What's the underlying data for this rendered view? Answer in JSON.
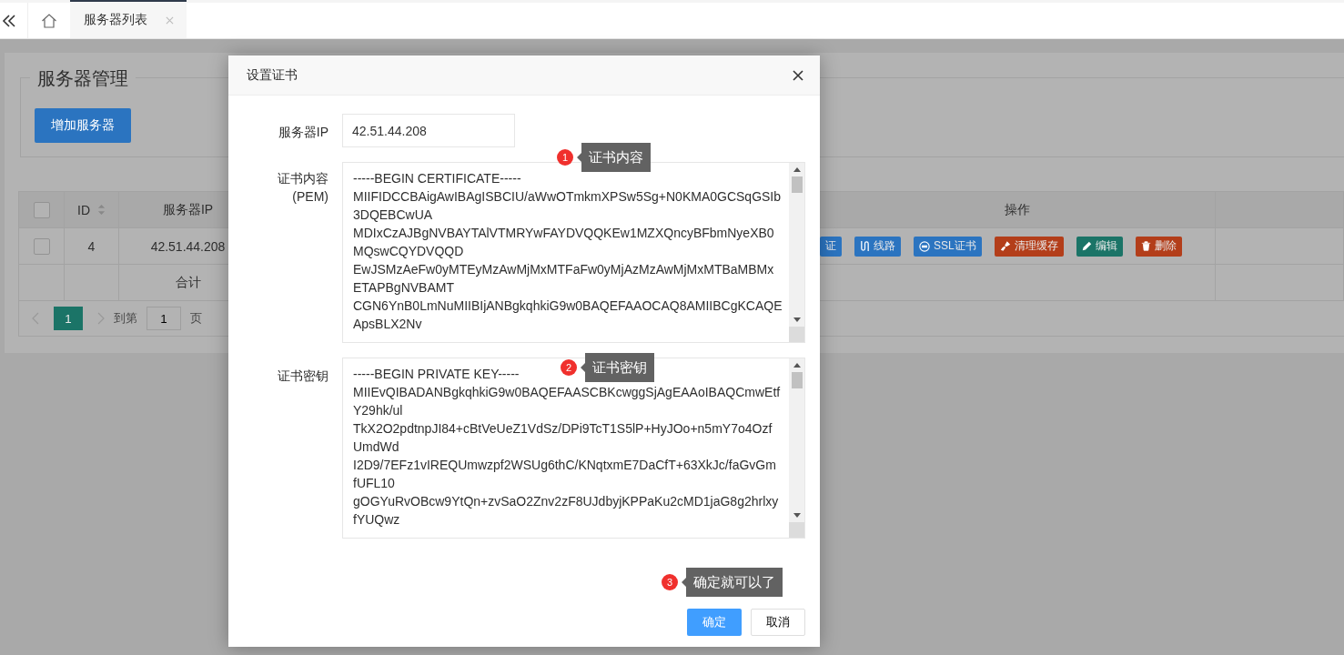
{
  "tabs": [
    {
      "label": "服务器列表",
      "selected": true,
      "closable": true
    }
  ],
  "panel": {
    "legend": "服务器管理",
    "add_button": "增加服务器"
  },
  "table": {
    "select_all": {
      "checked": false
    },
    "columns": [
      {
        "label": "ID",
        "sortable": true
      },
      {
        "label": "服务器IP",
        "sortable": false
      },
      {
        "label": "操作",
        "sortable": false
      }
    ],
    "rows": [
      {
        "checked": false,
        "id": "4",
        "ip": "42.51.44.208",
        "actions": [
          {
            "label": "证",
            "kind": "none",
            "color": "#2b74c0"
          },
          {
            "label": "线路",
            "kind": "link",
            "color": "#2b74c0"
          },
          {
            "label": "SSL证书",
            "kind": "ssl",
            "color": "#2b74c0"
          },
          {
            "label": "清理缓存",
            "kind": "brush",
            "color": "#b33e1a"
          },
          {
            "label": "编辑",
            "kind": "edit",
            "color": "#1b7467"
          },
          {
            "label": "删除",
            "kind": "trash",
            "color": "#b33e1a"
          }
        ]
      }
    ],
    "total_label": "合计"
  },
  "pagination": {
    "pages": [
      {
        "label": "1",
        "selected": true
      }
    ],
    "goto_label": "到第",
    "page_value": "1",
    "page_label": "页"
  },
  "dialog": {
    "title": "设置证书",
    "ip_label": "服务器IP",
    "ip_value": "42.51.44.208",
    "cert_label": "证书内容",
    "cert_label_sub": "(PEM)",
    "cert_lines": [
      "-----BEGIN CERTIFICATE-----",
      "MIIFIDCCBAigAwIBAgISBCIU/aWwOTmkmXPSw5Sg+N0KMA0GCSqGSIb",
      "3DQEBCwUA",
      "MDIxCzAJBgNVBAYTAlVTMRYwFAYDVQQKEw1MZXQncyBFbmNyeXB0",
      "MQswCQYDVQQD",
      "EwJSMzAeFw0yMTEyMzAwMjMxMTFaFw0yMjAzMzAwMjMxMTBaMBMx",
      "ETAPBgNVBAMT",
      "CGN6YnB0LmNuMIIBIjANBgkqhkiG9w0BAQEFAAOCAQ8AMIIBCgKCAQE",
      "ApsBLX2Nv"
    ],
    "key_label": "证书密钥",
    "key_lines": [
      "-----BEGIN PRIVATE KEY-----",
      "MIIEvQIBADANBgkqhkiG9w0BAQEFAASCBKcwggSjAgEAAoIBAQCmwEtf",
      "Y29hk/ul",
      "TkX2O2pdtnpJI84+cBtVeUeZ1VdSz/DPi9TcT1S5lP+HyJOo+n5mY7o4Ozf",
      "UmdWd",
      "I2D9/7EFz1vIREQUmwzpf2WSUg6thC/KNqtxmE7DaCfT+63XkJc/faGvGm",
      "fUFL10",
      "gOGYuRvOBcw9YtQn+zvSaO2Znv2zF8UJdbyjKPPaKu2cMD1jaG8g2hrlxy",
      "fYUQwz"
    ],
    "callouts": [
      {
        "number": "1",
        "text": "证书内容"
      },
      {
        "number": "2",
        "text": "证书密钥"
      },
      {
        "number": "3",
        "text": "确定就可以了"
      }
    ],
    "confirm": "确定",
    "cancel": "取消"
  }
}
